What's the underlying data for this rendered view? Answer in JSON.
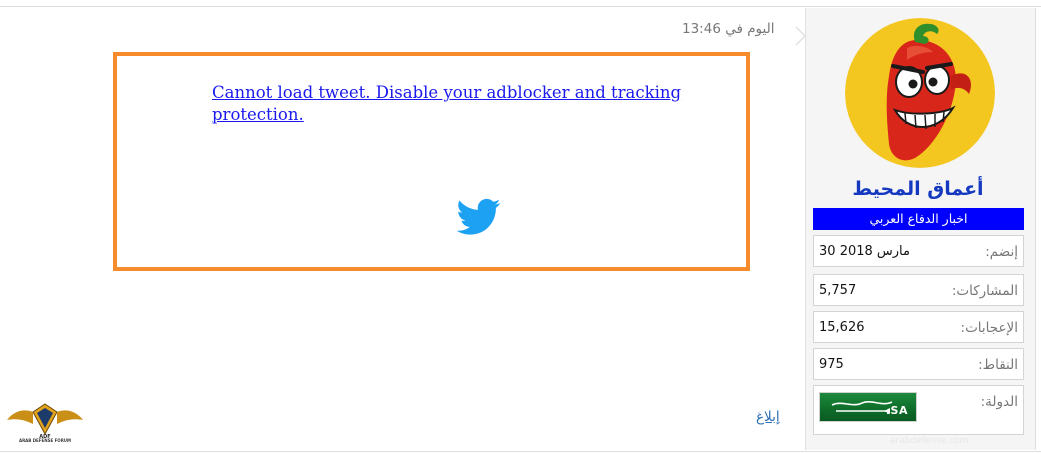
{
  "post": {
    "date": "اليوم في 13:46",
    "tweet_embed": {
      "error_message": "Cannot load tweet. Disable your adblocker and tracking protection.",
      "icon": "twitter-bird-icon"
    },
    "report_label": "إبلاغ"
  },
  "user": {
    "avatar": "red-pepper-cartoon-avatar",
    "name": "أعماق المحيط",
    "title": "اخبار الدفاع العربي",
    "fields": [
      {
        "label": "إنضم:",
        "value": "30 مارس 2018"
      },
      {
        "label": "المشاركات:",
        "value": "5,757"
      },
      {
        "label": "الإعجابات:",
        "value": "15,626"
      },
      {
        "label": "النقاط:",
        "value": "975"
      }
    ],
    "country": {
      "label": "الدولة:",
      "flag_text": ".SA",
      "flag_icon": "saudi-arabia-flag-icon"
    }
  },
  "watermark": {
    "logo": "arab-defense-forum-logo",
    "text": "ARAB DEFENSE FORUM",
    "site": "arabdefense.com"
  },
  "colors": {
    "tweet_border": "#f68b2c",
    "username": "#1438c0",
    "title_bg": "#0000ff",
    "link": "#1a1aee",
    "report_link": "#2d6db4",
    "twitter_blue": "#1da1f2"
  }
}
